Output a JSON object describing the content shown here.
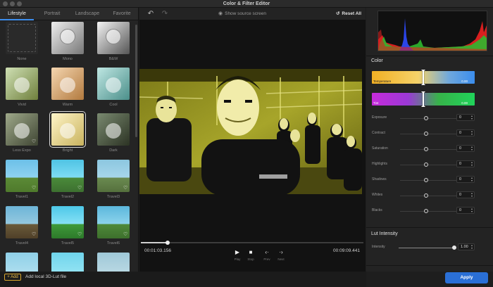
{
  "window": {
    "title": "Color & Filter Editor"
  },
  "tabs": [
    "Lifestyle",
    "Portrait",
    "Landscape",
    "Favorite"
  ],
  "filters": [
    {
      "label": "None"
    },
    {
      "label": "Mono"
    },
    {
      "label": "B&W"
    },
    {
      "label": "Vivid"
    },
    {
      "label": "Warm"
    },
    {
      "label": "Cool"
    },
    {
      "label": "Less Expo"
    },
    {
      "label": "Bright"
    },
    {
      "label": "Dark"
    },
    {
      "label": "Travel1"
    },
    {
      "label": "Travel2"
    },
    {
      "label": "Travel3"
    },
    {
      "label": "Travel4"
    },
    {
      "label": "Travel5"
    },
    {
      "label": "Travel6"
    },
    {
      "label": ""
    },
    {
      "label": ""
    },
    {
      "label": ""
    }
  ],
  "selected_filter": "Bright",
  "add_bar": {
    "button": "+ Add",
    "text": "Add local 3D-Lut file"
  },
  "toolbar": {
    "show_source": "Show source screen",
    "reset_all": "Reset All"
  },
  "player": {
    "current_time": "00:01:03.156",
    "total_time": "00:09:09.441",
    "progress": 0.12,
    "controls": [
      "Play",
      "Stop",
      "Prev",
      "Next"
    ]
  },
  "color": {
    "title": "Color",
    "temperature": {
      "label": "Temperature",
      "value": "0.00"
    },
    "tint": {
      "label": "Tint",
      "value": "0.00"
    },
    "adjustments": [
      {
        "label": "Exposure",
        "value": "0"
      },
      {
        "label": "Contract",
        "value": "0"
      },
      {
        "label": "Saturation",
        "value": "0"
      },
      {
        "label": "Highlights",
        "value": "0"
      },
      {
        "label": "Shadows",
        "value": "0"
      },
      {
        "label": "Whites",
        "value": "0"
      },
      {
        "label": "Blacks",
        "value": "0"
      }
    ]
  },
  "lut": {
    "title": "Lut Intensity",
    "label": "Intensity",
    "value": "1.00"
  },
  "apply_button": "Apply",
  "colors": {
    "accent": "#2a6fd6",
    "add_button": "#d9a72e",
    "tab_underline": "#3b8ded"
  }
}
